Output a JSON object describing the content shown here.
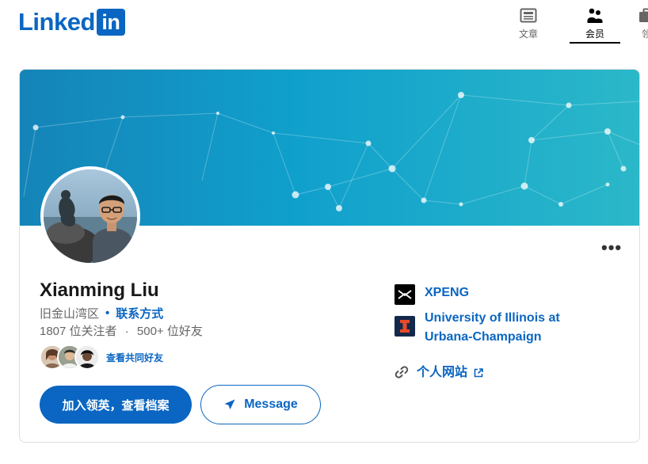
{
  "header": {
    "logo_text": "Linked",
    "logo_box_text": "in",
    "nav": [
      {
        "label": "文章",
        "icon": "articles-icon"
      },
      {
        "label": "会员",
        "icon": "members-icon",
        "active": true
      },
      {
        "label": "领",
        "icon": "jobs-icon"
      }
    ]
  },
  "profile": {
    "name": "Xianming Liu",
    "location": "旧金山湾区",
    "contact_link": "联系方式",
    "followers": "1807 位关注者",
    "connections": "500+ 位好友",
    "stats_separator": "·",
    "mutual_link": "查看共同好友",
    "join_button": "加入领英，查看档案",
    "message_button": "Message",
    "more_icon": "more-horizontal-icon",
    "more_text": "•••"
  },
  "right": {
    "company": "XPENG",
    "school": "University of Illinois at Urbana-Champaign",
    "website": "个人网站"
  },
  "colors": {
    "brand_blue": "#0a66c2",
    "banner_start": "#1584b8",
    "banner_end": "#2bb8c9",
    "text_secondary": "#666666"
  }
}
